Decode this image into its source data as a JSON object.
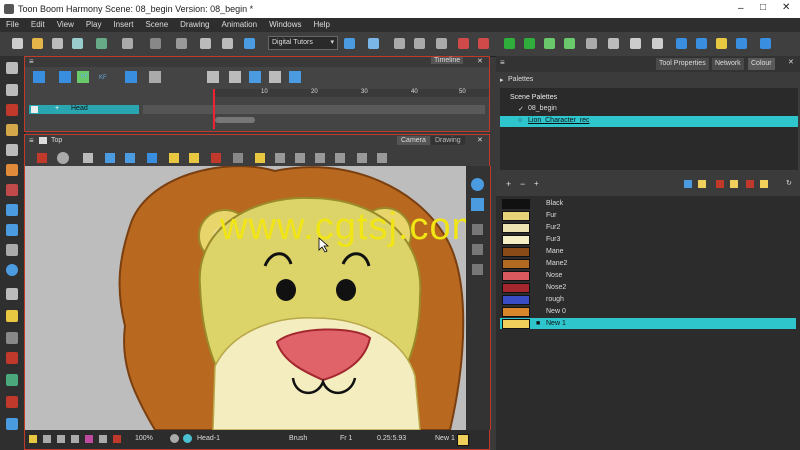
{
  "title_bar": {
    "title": "Toon Boom Harmony Scene: 08_begin Version: 08_begin *"
  },
  "menu": [
    "File",
    "Edit",
    "View",
    "Play",
    "Insert",
    "Scene",
    "Drawing",
    "Animation",
    "Windows",
    "Help"
  ],
  "toolbar": {
    "workspace": "Digital Tutors"
  },
  "timeline": {
    "tab": "Timeline",
    "layer_name": "Head",
    "frame_numbers": [
      "10",
      "20",
      "30",
      "40",
      "50"
    ]
  },
  "view": {
    "view_label": "Top",
    "tabs": [
      "Camera",
      "Drawing"
    ]
  },
  "status": {
    "zoom": "100%",
    "drawing": "Head-1",
    "tool": "Brush",
    "frame": "Fr 1",
    "coords": "0.25:5.93",
    "colour": "New 1"
  },
  "right_panel": {
    "tabs": [
      "Tool Properties",
      "Network",
      "Colour"
    ],
    "palettes_label": "Palettes",
    "scene_palettes_label": "Scene Palettes",
    "palettes": [
      "08_begin",
      "Lion_Character_rec"
    ],
    "colours": [
      {
        "name": "Black",
        "color": "#111111"
      },
      {
        "name": "Fur",
        "color": "#e7d27a"
      },
      {
        "name": "Fur2",
        "color": "#ece3b0"
      },
      {
        "name": "Fur3",
        "color": "#f5efc8"
      },
      {
        "name": "Mane",
        "color": "#8a4a17"
      },
      {
        "name": "Mane2",
        "color": "#b06a22"
      },
      {
        "name": "Nose",
        "color": "#d9595f"
      },
      {
        "name": "Nose2",
        "color": "#a3272e"
      },
      {
        "name": "rough",
        "color": "#3a4bc6"
      },
      {
        "name": "New 0",
        "color": "#d9852a"
      },
      {
        "name": "New 1",
        "color": "#f0cf5a"
      }
    ]
  },
  "watermark": "www.cgtsj.com"
}
